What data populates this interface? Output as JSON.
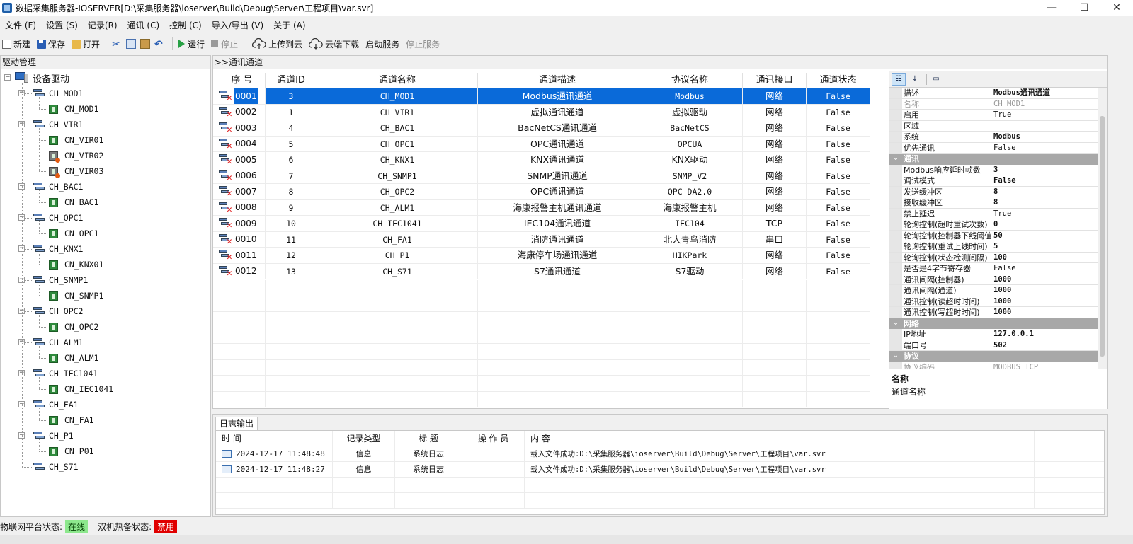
{
  "window": {
    "title": "数据采集服务器-IOSERVER[D:\\采集服务器\\ioserver\\Build\\Debug\\Server\\工程项目\\var.svr]",
    "minimize_glyph": "—",
    "maximize_glyph": "☐",
    "close_glyph": "✕"
  },
  "menu": [
    "文件 (F)",
    "设置 (S)",
    "记录(R)",
    "通讯 (C)",
    "控制 (C)",
    "导入/导出 (V)",
    "关于 (A)"
  ],
  "toolbar": {
    "new": "新建",
    "save": "保存",
    "open": "打开",
    "run": "运行",
    "stop": "停止",
    "upload_cloud": "上传到云",
    "download_cloud": "云端下载",
    "start_service": "启动服务",
    "stop_service": "停止服务"
  },
  "tree": {
    "header": "驱动管理",
    "root": "设备驱动",
    "channels": [
      {
        "name": "CH_MOD1",
        "devices": [
          {
            "name": "CN_MOD1",
            "warn": false
          }
        ]
      },
      {
        "name": "CH_VIR1",
        "devices": [
          {
            "name": "CN_VIR01",
            "warn": false
          },
          {
            "name": "CN_VIR02",
            "warn": true
          },
          {
            "name": "CN_VIR03",
            "warn": true
          }
        ]
      },
      {
        "name": "CH_BAC1",
        "devices": [
          {
            "name": "CN_BAC1",
            "warn": false
          }
        ]
      },
      {
        "name": "CH_OPC1",
        "devices": [
          {
            "name": "CN_OPC1",
            "warn": false
          }
        ]
      },
      {
        "name": "CH_KNX1",
        "devices": [
          {
            "name": "CN_KNX01",
            "warn": false
          }
        ]
      },
      {
        "name": "CH_SNMP1",
        "devices": [
          {
            "name": "CN_SNMP1",
            "warn": false
          }
        ]
      },
      {
        "name": "CH_OPC2",
        "devices": [
          {
            "name": "CN_OPC2",
            "warn": false
          }
        ]
      },
      {
        "name": "CH_ALM1",
        "devices": [
          {
            "name": "CN_ALM1",
            "warn": false
          }
        ]
      },
      {
        "name": "CH_IEC1041",
        "devices": [
          {
            "name": "CN_IEC1041",
            "warn": false
          }
        ]
      },
      {
        "name": "CH_FA1",
        "devices": [
          {
            "name": "CN_FA1",
            "warn": false
          }
        ]
      },
      {
        "name": "CH_P1",
        "devices": [
          {
            "name": "CN_P01",
            "warn": false
          }
        ]
      },
      {
        "name": "CH_S71",
        "devices": []
      }
    ]
  },
  "channel_table": {
    "header": ">>通讯通道",
    "columns": [
      "序    号",
      "通道ID",
      "通道名称",
      "通道描述",
      "协议名称",
      "通讯接口",
      "通道状态"
    ],
    "selected_index": 0,
    "rows": [
      [
        "0001",
        "3",
        "CH_MOD1",
        "Modbus通讯通道",
        "Modbus",
        "网络",
        "False"
      ],
      [
        "0002",
        "1",
        "CH_VIR1",
        "虚拟通讯通道",
        "虚拟驱动",
        "网络",
        "False"
      ],
      [
        "0003",
        "4",
        "CH_BAC1",
        "BacNetCS通讯通道",
        "BacNetCS",
        "网络",
        "False"
      ],
      [
        "0004",
        "5",
        "CH_OPC1",
        "OPC通讯通道",
        "OPCUA",
        "网络",
        "False"
      ],
      [
        "0005",
        "6",
        "CH_KNX1",
        "KNX通讯通道",
        "KNX驱动",
        "网络",
        "False"
      ],
      [
        "0006",
        "7",
        "CH_SNMP1",
        "SNMP通讯通道",
        "SNMP_V2",
        "网络",
        "False"
      ],
      [
        "0007",
        "8",
        "CH_OPC2",
        "OPC通讯通道",
        "OPC DA2.0",
        "网络",
        "False"
      ],
      [
        "0008",
        "9",
        "CH_ALM1",
        "海康报警主机通讯通道",
        "海康报警主机",
        "网络",
        "False"
      ],
      [
        "0009",
        "10",
        "CH_IEC1041",
        "IEC104通讯通道",
        "IEC104",
        "TCP",
        "False"
      ],
      [
        "0010",
        "11",
        "CH_FA1",
        "消防通讯通道",
        "北大青鸟消防",
        "串口",
        "False"
      ],
      [
        "0011",
        "12",
        "CH_P1",
        "海康停车场通讯通道",
        "HIKPark",
        "网络",
        "False"
      ],
      [
        "0012",
        "13",
        "CH_S71",
        "S7通讯通道",
        "S7驱动",
        "网络",
        "False"
      ]
    ]
  },
  "properties": {
    "toolbar_icons": [
      "categorized-icon",
      "alphabetical-icon",
      "property-pages-icon"
    ],
    "rows": [
      {
        "type": "prop",
        "key": "描述",
        "value": "Modbus通讯通道",
        "bold": true
      },
      {
        "type": "prop",
        "key": "名称",
        "value": "CH_MOD1",
        "muted": true
      },
      {
        "type": "prop",
        "key": "启用",
        "value": "True"
      },
      {
        "type": "prop",
        "key": "区域",
        "value": ""
      },
      {
        "type": "prop",
        "key": "系统",
        "value": "Modbus",
        "bold": true
      },
      {
        "type": "prop",
        "key": "优先通讯",
        "value": "False"
      },
      {
        "type": "cat",
        "key": "通讯"
      },
      {
        "type": "prop",
        "key": "Modbus响应延时帧数",
        "value": "3",
        "bold": true
      },
      {
        "type": "prop",
        "key": "调试模式",
        "value": "False",
        "bold": true
      },
      {
        "type": "prop",
        "key": "发送缓冲区",
        "value": "8",
        "bold": true
      },
      {
        "type": "prop",
        "key": "接收缓冲区",
        "value": "8",
        "bold": true
      },
      {
        "type": "prop",
        "key": "禁止延迟",
        "value": "True"
      },
      {
        "type": "prop",
        "key": "轮询控制(超时重试次数)",
        "value": "0",
        "bold": true
      },
      {
        "type": "prop",
        "key": "轮询控制(控制器下线阈值",
        "value": "50",
        "bold": true
      },
      {
        "type": "prop",
        "key": "轮询控制(重试上线时间)",
        "value": "5",
        "bold": true
      },
      {
        "type": "prop",
        "key": "轮询控制(状态检测间隔)",
        "value": "100",
        "bold": true
      },
      {
        "type": "prop",
        "key": "是否是4字节寄存器",
        "value": "False"
      },
      {
        "type": "prop",
        "key": "通讯间隔(控制器)",
        "value": "1000",
        "bold": true
      },
      {
        "type": "prop",
        "key": "通讯间隔(通道)",
        "value": "1000",
        "bold": true
      },
      {
        "type": "prop",
        "key": "通讯控制(读超时时间)",
        "value": "1000",
        "bold": true
      },
      {
        "type": "prop",
        "key": "通讯控制(写超时时间)",
        "value": "1000",
        "bold": true
      },
      {
        "type": "cat",
        "key": "网络"
      },
      {
        "type": "prop",
        "key": "IP地址",
        "value": "127.0.0.1",
        "bold": true
      },
      {
        "type": "prop",
        "key": "端口号",
        "value": "502",
        "bold": true
      },
      {
        "type": "cat",
        "key": "协议"
      },
      {
        "type": "prop",
        "key": "协议编码",
        "value": "MODBUS_TCP",
        "muted": true
      }
    ],
    "desc_title": "名称",
    "desc_text": "通道名称"
  },
  "log": {
    "tab": "日志输出",
    "columns": [
      "时    间",
      "记录类型",
      "标    题",
      "操 作 员",
      "内    容"
    ],
    "rows": [
      [
        "2024-12-17 11:48:48",
        "信息",
        "系统日志",
        "",
        "载入文件成功:D:\\采集服务器\\ioserver\\Build\\Debug\\Server\\工程项目\\var.svr"
      ],
      [
        "2024-12-17 11:48:27",
        "信息",
        "系统日志",
        "",
        "载入文件成功:D:\\采集服务器\\ioserver\\Build\\Debug\\Server\\工程项目\\var.svr"
      ]
    ]
  },
  "status": {
    "iot_label": "物联网平台状态:",
    "iot_value": "在线",
    "hotbackup_label": "双机热备状态:",
    "hotbackup_value": "禁用"
  }
}
